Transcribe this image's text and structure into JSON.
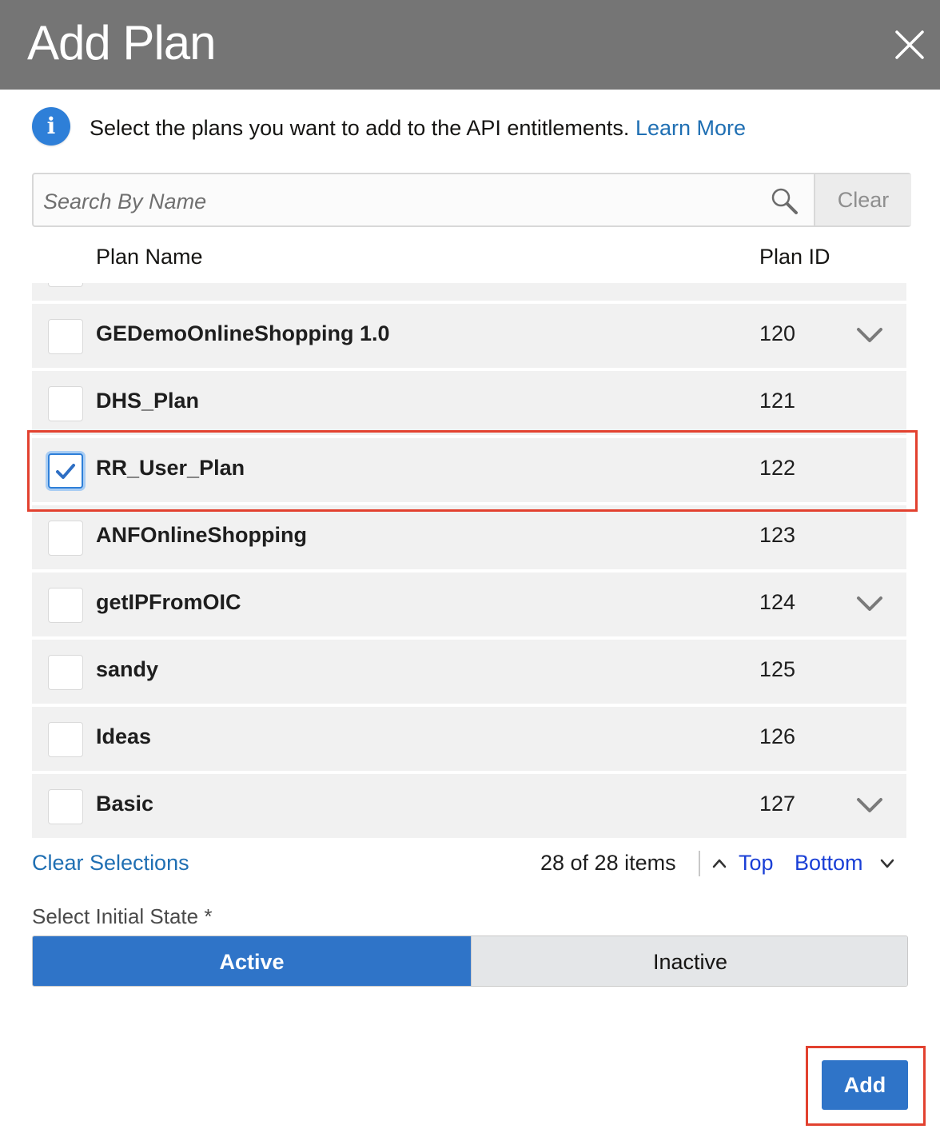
{
  "dialog": {
    "title": "Add Plan",
    "close_icon": "close-icon"
  },
  "info": {
    "icon": "info-icon",
    "icon_glyph": "i",
    "message": "Select the plans you want to add to the API entitlements.",
    "link_label": "Learn More"
  },
  "search": {
    "placeholder": "Search By Name",
    "value": "",
    "icon": "search-icon",
    "clear_label": "Clear"
  },
  "table": {
    "columns": [
      "Plan Name",
      "Plan ID"
    ],
    "rows": [
      {
        "name": "GEDemoOnlineShopping 1.0",
        "id": "120",
        "checked": false,
        "expandable": true
      },
      {
        "name": "DHS_Plan",
        "id": "121",
        "checked": false,
        "expandable": false
      },
      {
        "name": "RR_User_Plan",
        "id": "122",
        "checked": true,
        "expandable": false
      },
      {
        "name": "ANFOnlineShopping",
        "id": "123",
        "checked": false,
        "expandable": false
      },
      {
        "name": "getIPFromOIC",
        "id": "124",
        "checked": false,
        "expandable": true
      },
      {
        "name": "sandy",
        "id": "125",
        "checked": false,
        "expandable": false
      },
      {
        "name": "Ideas",
        "id": "126",
        "checked": false,
        "expandable": false
      },
      {
        "name": "Basic",
        "id": "127",
        "checked": false,
        "expandable": true
      }
    ]
  },
  "footer": {
    "clear_selections": "Clear Selections",
    "item_count": "28 of 28 items",
    "top_label": "Top",
    "bottom_label": "Bottom"
  },
  "initial_state": {
    "label": "Select Initial State *",
    "options": [
      "Active",
      "Inactive"
    ],
    "selected": "Active"
  },
  "actions": {
    "add_label": "Add"
  },
  "colors": {
    "header_bg": "#757575",
    "accent": "#2f74c8",
    "link": "#1f6fb3",
    "highlight": "#e2412f"
  }
}
